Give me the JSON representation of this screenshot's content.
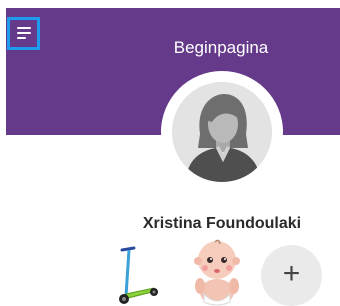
{
  "header": {
    "title": "Beginpagina",
    "background_color": "#653a8a",
    "menu_icon": "hamburger-menu-icon",
    "menu_focus_color": "#1e9cf0"
  },
  "profile": {
    "name": "Xristina Foundoulaki",
    "avatar_icon": "default-female-avatar"
  },
  "children": [
    {
      "icon": "scooter-icon"
    },
    {
      "icon": "baby-icon"
    }
  ],
  "add_button": {
    "label": "+",
    "icon": "plus-icon"
  }
}
